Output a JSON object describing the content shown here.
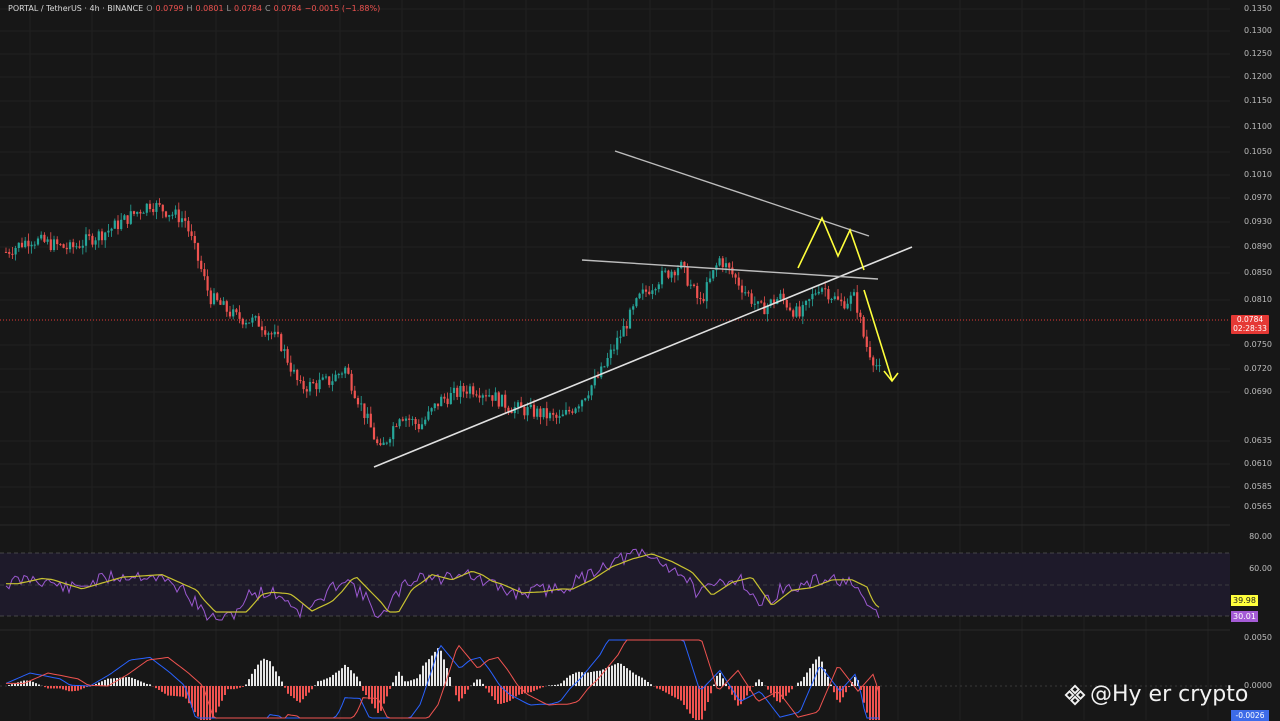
{
  "header": {
    "symbol": "PORTAL / TetherUS · 4h · BINANCE",
    "open_k": "O",
    "open_v": "0.0799",
    "high_k": "H",
    "high_v": "0.0801",
    "low_k": "L",
    "low_v": "0.0784",
    "close_k": "C",
    "close_v": "0.0784",
    "change_v": "−0.0015 (−1.88%)"
  },
  "price_axis": {
    "ticks": [
      "0.1350",
      "0.1300",
      "0.1250",
      "0.1200",
      "0.1150",
      "0.1100",
      "0.1050",
      "0.1010",
      "0.0970",
      "0.0930",
      "0.0890",
      "0.0850",
      "0.0810",
      "0.0750",
      "0.0720",
      "0.0690",
      "0.0635",
      "0.0610",
      "0.0585",
      "0.0565"
    ],
    "current_price": "0.0784",
    "countdown": "02:28:33"
  },
  "rsi_axis": {
    "ticks": [
      "80.00",
      "60.00"
    ],
    "ma_value": "39.98",
    "rsi_value": "30.01"
  },
  "macd_axis": {
    "ticks": [
      "0.0050",
      "0.0000"
    ],
    "value": "-0.0026"
  },
  "colors": {
    "up": "#26a69a",
    "down": "#ef5350",
    "rsi": "#9b59d0",
    "rsi_ma": "#c8c230",
    "macd": "#2962ff",
    "signal": "#ef5350",
    "trendline": "#e0e0e0",
    "drawing": "#ffff3b"
  },
  "watermark": {
    "text": "@Hy  er crypto",
    "icon": "diamond-logo-icon"
  },
  "chart_data": {
    "type": "candlestick",
    "symbol": "PORTAL/USDT",
    "timeframe": "4h",
    "ylim": [
      0.0555,
      0.136
    ],
    "approx_close_path": [
      {
        "x": 0,
        "y": 0.0965
      },
      {
        "x": 30,
        "y": 0.099
      },
      {
        "x": 70,
        "y": 0.0975
      },
      {
        "x": 110,
        "y": 0.1005
      },
      {
        "x": 150,
        "y": 0.1045
      },
      {
        "x": 185,
        "y": 0.102
      },
      {
        "x": 210,
        "y": 0.09
      },
      {
        "x": 235,
        "y": 0.087
      },
      {
        "x": 260,
        "y": 0.086
      },
      {
        "x": 280,
        "y": 0.083
      },
      {
        "x": 300,
        "y": 0.076
      },
      {
        "x": 330,
        "y": 0.077
      },
      {
        "x": 345,
        "y": 0.079
      },
      {
        "x": 370,
        "y": 0.07
      },
      {
        "x": 380,
        "y": 0.066
      },
      {
        "x": 400,
        "y": 0.072
      },
      {
        "x": 420,
        "y": 0.07
      },
      {
        "x": 440,
        "y": 0.074
      },
      {
        "x": 470,
        "y": 0.076
      },
      {
        "x": 490,
        "y": 0.075
      },
      {
        "x": 510,
        "y": 0.073
      },
      {
        "x": 540,
        "y": 0.072
      },
      {
        "x": 560,
        "y": 0.071
      },
      {
        "x": 580,
        "y": 0.074
      },
      {
        "x": 600,
        "y": 0.078
      },
      {
        "x": 620,
        "y": 0.084
      },
      {
        "x": 640,
        "y": 0.09
      },
      {
        "x": 660,
        "y": 0.093
      },
      {
        "x": 680,
        "y": 0.095
      },
      {
        "x": 700,
        "y": 0.089
      },
      {
        "x": 720,
        "y": 0.096
      },
      {
        "x": 740,
        "y": 0.092
      },
      {
        "x": 760,
        "y": 0.088
      },
      {
        "x": 780,
        "y": 0.09
      },
      {
        "x": 800,
        "y": 0.087
      },
      {
        "x": 820,
        "y": 0.092
      },
      {
        "x": 840,
        "y": 0.089
      },
      {
        "x": 855,
        "y": 0.09
      },
      {
        "x": 865,
        "y": 0.083
      },
      {
        "x": 880,
        "y": 0.0784
      }
    ]
  }
}
